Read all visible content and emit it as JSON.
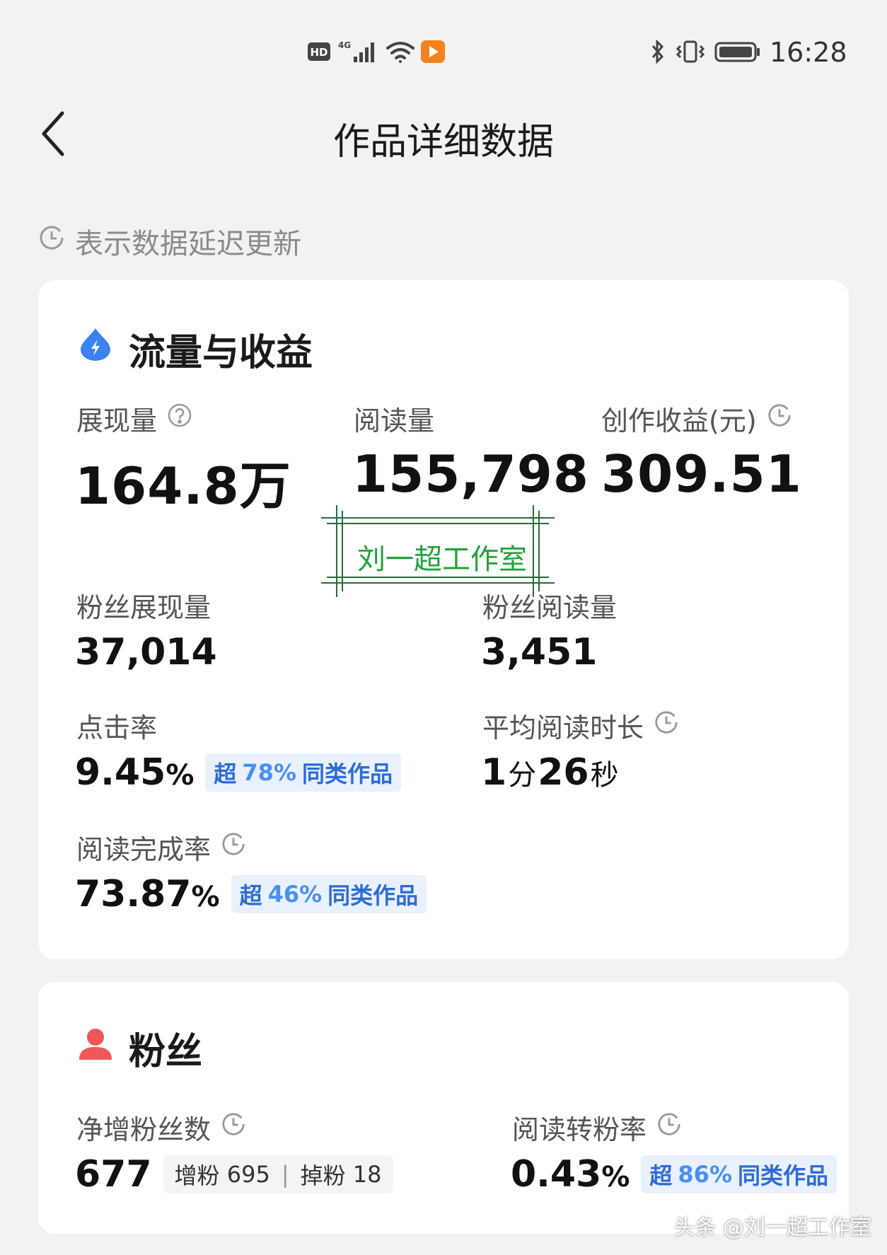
{
  "status_bar": {
    "time": "16:28",
    "left_icons": [
      "hd-icon",
      "4g-signal-icon",
      "wifi-icon",
      "video-app-icon"
    ],
    "right_icons": [
      "bluetooth-icon",
      "vibrate-icon",
      "battery-icon"
    ],
    "hd_label": "HD",
    "network_label": "4G"
  },
  "header": {
    "title": "作品详细数据",
    "back_icon": "chevron-left-icon"
  },
  "delay_note": "表示数据延迟更新",
  "traffic": {
    "section_title": "流量与收益",
    "impressions": {
      "label": "展现量",
      "value": "164.8万"
    },
    "reads": {
      "label": "阅读量",
      "value": "155,798"
    },
    "earnings": {
      "label": "创作收益(元)",
      "value": "309.51"
    },
    "fan_impressions": {
      "label": "粉丝展现量",
      "value": "37,014"
    },
    "fan_reads": {
      "label": "粉丝阅读量",
      "value": "3,451"
    },
    "ctr": {
      "label": "点击率",
      "value": "9.45",
      "unit": "%",
      "badge_prefix": "超",
      "badge_pct": "78%",
      "badge_suffix": "同类作品"
    },
    "avg_read_time": {
      "label": "平均阅读时长",
      "minutes": "1",
      "min_unit": "分",
      "seconds": "26",
      "sec_unit": "秒"
    },
    "completion": {
      "label": "阅读完成率",
      "value": "73.87",
      "unit": "%",
      "badge_prefix": "超",
      "badge_pct": "46%",
      "badge_suffix": "同类作品"
    }
  },
  "fans": {
    "section_title": "粉丝",
    "net_gain": {
      "label": "净增粉丝数",
      "value": "677",
      "gain_label": "增粉",
      "gain_value": "695",
      "loss_label": "掉粉",
      "loss_value": "18"
    },
    "conversion": {
      "label": "阅读转粉率",
      "value": "0.43",
      "unit": "%",
      "badge_prefix": "超",
      "badge_pct": "86%",
      "badge_suffix": "同类作品"
    }
  },
  "watermark": {
    "stamp_text": "刘一超工作室",
    "footer_text": "头条 @刘一超工作室"
  },
  "colors": {
    "accent_blue": "#2f6bd6",
    "badge_bg": "#e8f1fd",
    "fan_icon_red": "#f0565a",
    "stamp_green": "#23a33a"
  }
}
